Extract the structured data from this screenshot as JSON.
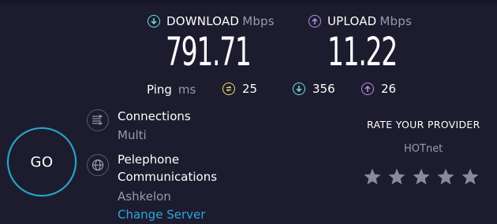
{
  "download": {
    "label": "DOWNLOAD",
    "unit": "Mbps",
    "value": "791.71",
    "icon": "download-arrow-icon",
    "color": "#6fe0e0"
  },
  "upload": {
    "label": "UPLOAD",
    "unit": "Mbps",
    "value": "11.22",
    "icon": "upload-arrow-icon",
    "color": "#b98fe8"
  },
  "ping": {
    "label": "Ping",
    "unit": "ms",
    "idle": {
      "value": "25",
      "icon": "ping-icon",
      "color": "#f5dd6a"
    },
    "download": {
      "value": "356",
      "icon": "download-arrow-icon"
    },
    "upload": {
      "value": "26",
      "icon": "upload-arrow-icon"
    }
  },
  "go": {
    "label": "GO",
    "color": "#2aa8c8"
  },
  "connections": {
    "title": "Connections",
    "value": "Multi",
    "icon": "connections-icon"
  },
  "server": {
    "title_line1": "Pelephone",
    "title_line2": "Communications",
    "location": "Ashkelon",
    "change_label": "Change Server",
    "icon": "globe-icon",
    "link_color": "#2ba7de"
  },
  "rating": {
    "title": "RATE YOUR PROVIDER",
    "provider": "HOTnet",
    "max_stars": 5,
    "selected_stars": 0
  }
}
